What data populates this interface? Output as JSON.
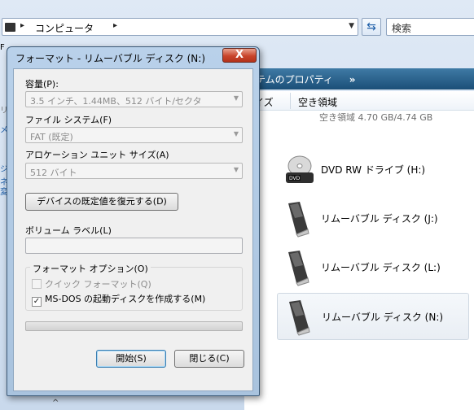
{
  "explorer": {
    "address": {
      "crumb": "コンピュータ"
    },
    "search": {
      "placeholder": "検索"
    },
    "command_bar": {
      "properties_label": "テムのプロパティ",
      "more_label": "»"
    },
    "columns": {
      "col1": "イズ",
      "col2": "空き領域"
    },
    "partial_free_text": "空き領域 4.70 GB/4.74 GB",
    "drives": [
      {
        "label": "DVD RW ドライブ (H:)",
        "icon": "dvd-drive-icon"
      },
      {
        "label": "リムーバブル ディスク (J:)",
        "icon": "usb-drive-icon"
      },
      {
        "label": "リムーバブル ディスク (L:)",
        "icon": "usb-drive-icon"
      },
      {
        "label": "リムーバブル ディスク (N:)",
        "icon": "usb-drive-icon",
        "selected": true
      }
    ],
    "left_strip": [
      "F",
      "リ",
      "メ",
      "ジ",
      "ネ",
      "変"
    ],
    "bottom_stub": "^"
  },
  "dialog": {
    "title": "フォーマット - リムーバブル ディスク (N:)",
    "close_label": "X",
    "capacity": {
      "label": "容量(P):",
      "value": "3.5 インチ、1.44MB、512 バイト/セクタ"
    },
    "filesystem": {
      "label": "ファイル システム(F)",
      "value": "FAT (既定)"
    },
    "allocation": {
      "label": "アロケーション ユニット サイズ(A)",
      "value": "512 バイト"
    },
    "restore_defaults_label": "デバイスの既定値を復元する(D)",
    "volume_label": {
      "label": "ボリューム ラベル(L)",
      "value": ""
    },
    "format_options": {
      "title": "フォーマット オプション(O)",
      "quick_format": {
        "label": "クイック フォーマット(Q)",
        "checked": false,
        "disabled": true
      },
      "msdos_boot": {
        "label": "MS-DOS の起動ディスクを作成する(M)",
        "checked": true,
        "disabled": false
      }
    },
    "progress": 0,
    "start_label": "開始(S)",
    "close_button_label": "閉じる(C)"
  },
  "colors": {
    "accent": "#1b4f78",
    "close": "#c9452b",
    "progress": "#3fbd3f"
  }
}
